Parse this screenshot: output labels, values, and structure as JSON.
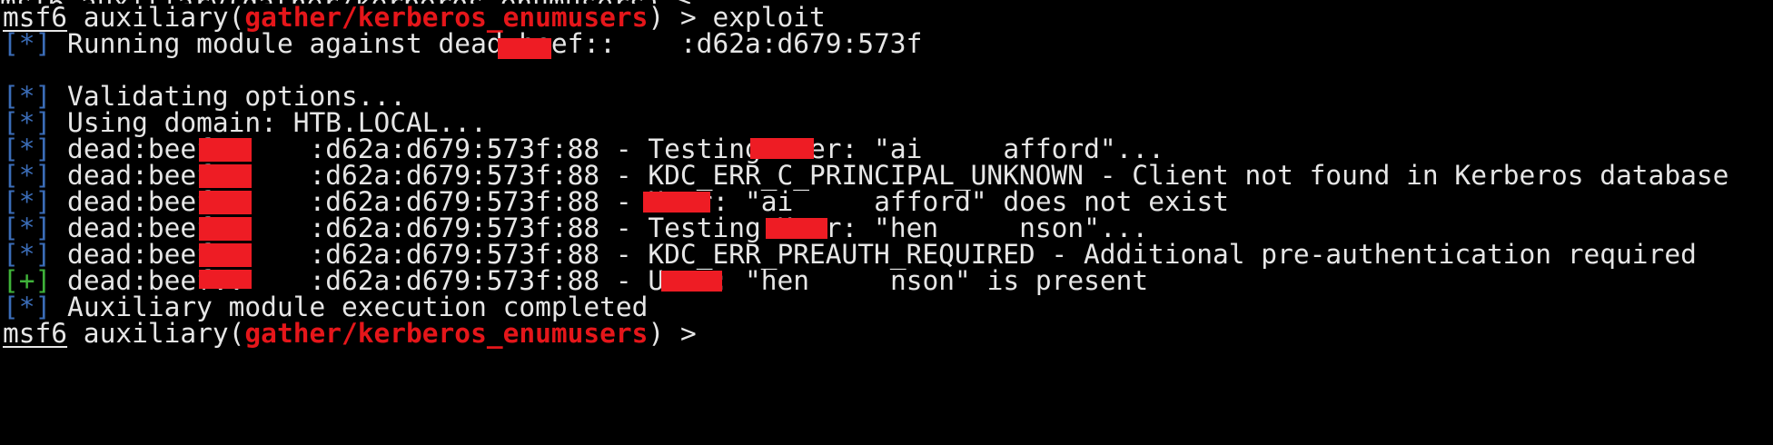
{
  "colors": {
    "background": "#000000",
    "text": "#e6e6e6",
    "module": "#e5161a",
    "info_tag": "#3b6db8",
    "success_tag": "#3fb33a",
    "redaction": "#ee1c24"
  },
  "prompt": {
    "name": "msf6",
    "open": " auxiliary(",
    "module": "gather/kerberos_enumusers",
    "close_cmd": ") > exploit",
    "close_idle": ") >"
  },
  "lines": {
    "l1_tag": "[*]",
    "l1_text": " Running module against dead:beef::",
    "l1_tail": ":d62a:d679:573f",
    "l3_tag": "[*]",
    "l3_text": " Validating options...",
    "l4_tag": "[*]",
    "l4_text": " Using domain: HTB.LOCAL...",
    "l5_tag": "[*]",
    "l5_text": " dead:beef::",
    "l5_mid": ":d62a:d679:573f:88 - Testing User: \"ai",
    "l5_tail": "afford\"...",
    "l6_tag": "[*]",
    "l6_text": " dead:beef::",
    "l6_tail": ":d62a:d679:573f:88 - KDC_ERR_C_PRINCIPAL_UNKNOWN - Client not found in Kerberos database",
    "l7_tag": "[*]",
    "l7_text": " dead:beef::",
    "l7_mid": ":d62a:d679:573f:88 - User: \"ai",
    "l7_tail": "afford\" does not exist",
    "l8_tag": "[*]",
    "l8_text": " dead:beef::",
    "l8_mid": ":d62a:d679:573f:88 - Testing User: \"hen",
    "l8_tail": "nson\"...",
    "l9_tag": "[*]",
    "l9_text": " dead:beef::",
    "l9_tail": ":d62a:d679:573f:88 - KDC_ERR_PREAUTH_REQUIRED - Additional pre-authentication required",
    "l10_tag": "[+]",
    "l10_text": " dead:beef::",
    "l10_mid": ":d62a:d679:573f:88 - User: \"hen",
    "l10_tail": "nson\" is present",
    "l11_tag": "[*]",
    "l11_text": " Auxiliary module execution completed"
  }
}
